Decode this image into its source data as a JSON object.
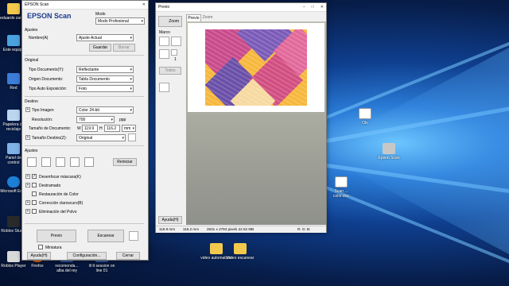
{
  "desktop": {
    "icons": [
      {
        "label": "eduardo zamar"
      },
      {
        "label": "Este equipo"
      },
      {
        "label": "Red"
      },
      {
        "label": "Papelera de reciclaje"
      },
      {
        "label": "Panel de control"
      },
      {
        "label": "Microsoft Edge"
      },
      {
        "label": "Roblox Studio"
      },
      {
        "label": "Roblox Player"
      },
      {
        "label": "Firefox"
      },
      {
        "label": "recomenda... alba del rey"
      },
      {
        "label": "lil tt session on line 01"
      },
      {
        "label": "video automatizar"
      },
      {
        "label": "Video escanear"
      },
      {
        "label": "Olo"
      },
      {
        "label": "Epson Scan"
      },
      {
        "label": "Scan ... color.doc"
      }
    ]
  },
  "epson": {
    "title": "EPSON Scan",
    "logo": "EPSON Scan",
    "mode_label": "Modo",
    "mode_value": "Modo Profesional",
    "ajustes_label": "Ajustes",
    "nombre_label": "Nombre(A)",
    "nombre_value": "Ajuste Actual",
    "guardar": "Guardar",
    "borrar": "Borrar",
    "original_label": "Original",
    "tipo_doc_label": "Tipo Documento(Y):",
    "tipo_doc_value": "Reflectante",
    "origen_label": "Origen Documento:",
    "origen_value": "Tabla Documento",
    "auto_exp_label": "Tipo Auto Exposición:",
    "auto_exp_value": "Foto",
    "destino_label": "Destino",
    "tipo_imagen_label": "Tipo Imagen",
    "tipo_imagen_value": "Color 24-bit",
    "resolucion_label": "Resolución:",
    "resolucion_value": "700",
    "ppp": "ppp",
    "tamano_doc_label": "Tamaño de Documento:",
    "w_label": "W",
    "w_value": "119.9",
    "h_label": "H",
    "h_value": "116.2",
    "unit_value": "mm",
    "tamano_dest_label": "Tamaño Destino(Z):",
    "tamano_dest_value": "Original",
    "ajustes2_label": "Ajustes",
    "reiniciar": "Reiniciar",
    "options": [
      {
        "label": "Desenfocar máscara(K)",
        "checked": true
      },
      {
        "label": "Destramado",
        "checked": false
      },
      {
        "label": "Restauración de Color",
        "checked": false
      },
      {
        "label": "Corrección claroscuro(B)",
        "checked": false
      },
      {
        "label": "Eliminación del Polvo",
        "checked": false
      }
    ],
    "previo": "Previo",
    "escanear": "Escanear",
    "miniatura": "Miniatura",
    "ayuda": "Ayuda(H)",
    "configuracion": "Configuración...",
    "cerrar": "Cerrar"
  },
  "preview": {
    "title": "Previo",
    "tabs": [
      "Previo",
      "Zoom"
    ],
    "zoom_btn": "Zoom",
    "marco_label": "Marco",
    "count": "1",
    "todos": "Todos",
    "ayuda": "Ayuda(H)",
    "status_w": "119.9 mm",
    "status_h": "116.2 mm",
    "status_px": "2831 x 2793 pixels 22.62 MB",
    "status_rgb": "R: G: B:"
  }
}
